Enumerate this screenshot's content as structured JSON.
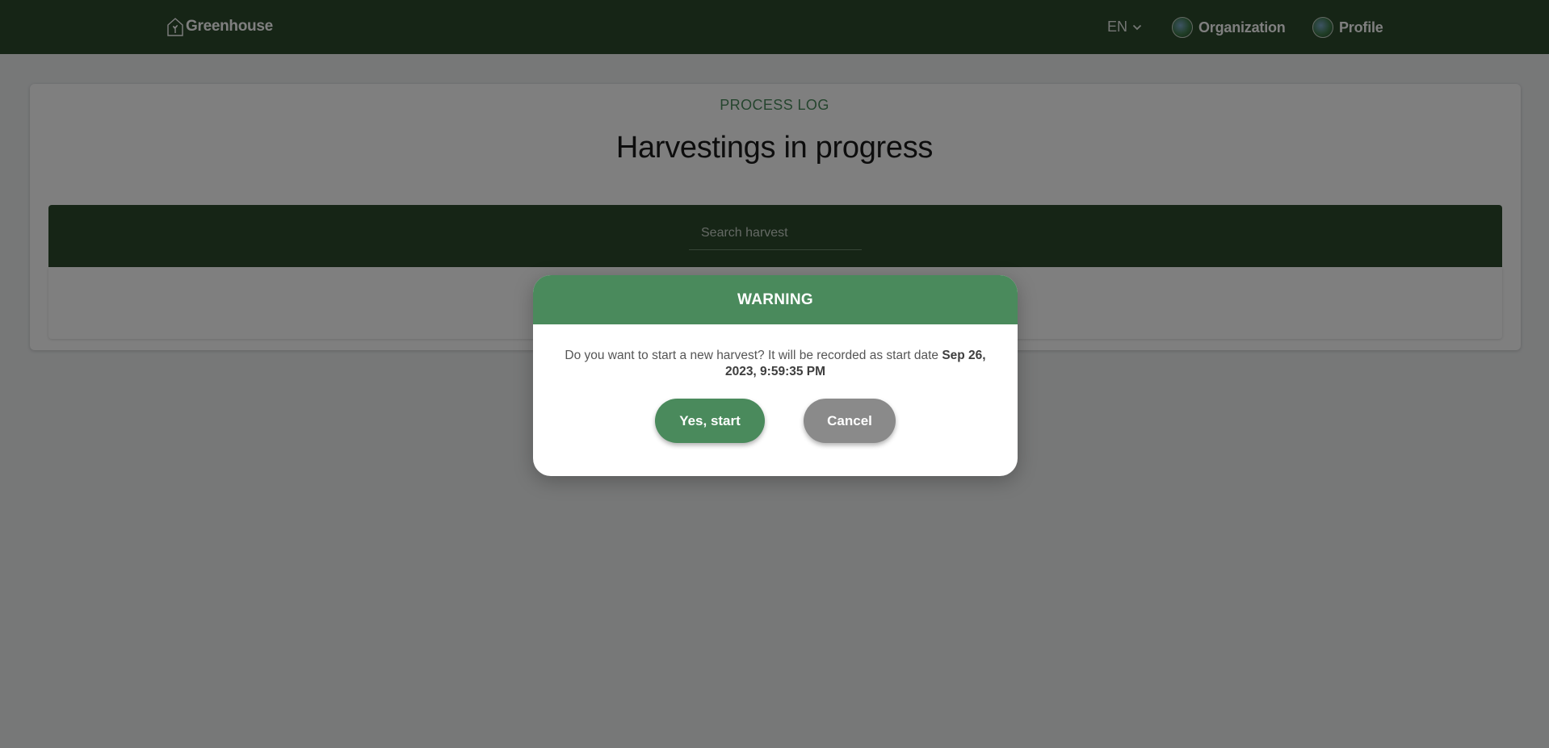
{
  "navbar": {
    "brand": "Greenhouse",
    "brand_icon": "greenhouse-logo-icon",
    "language": "EN",
    "language_icon": "chevron-down-icon",
    "organization_label": "Organization",
    "profile_label": "Profile",
    "avatar_icon": "globe-avatar-icon"
  },
  "page": {
    "eyebrow": "PROCESS LOG",
    "title": "Harvestings in progress",
    "search_placeholder": "Search harvest"
  },
  "modal": {
    "title": "WARNING",
    "message": "Do you want to start a new harvest? It will be recorded as start date",
    "date": "Sep 26, 2023, 9:59:35 PM",
    "confirm_label": "Yes, start",
    "cancel_label": "Cancel"
  },
  "colors": {
    "navbar_bg": "#2d4a2d",
    "accent_green": "#4a8a5c",
    "cancel_gray": "#8a8a8a",
    "overlay": "rgba(0,0,0,0.5)"
  }
}
